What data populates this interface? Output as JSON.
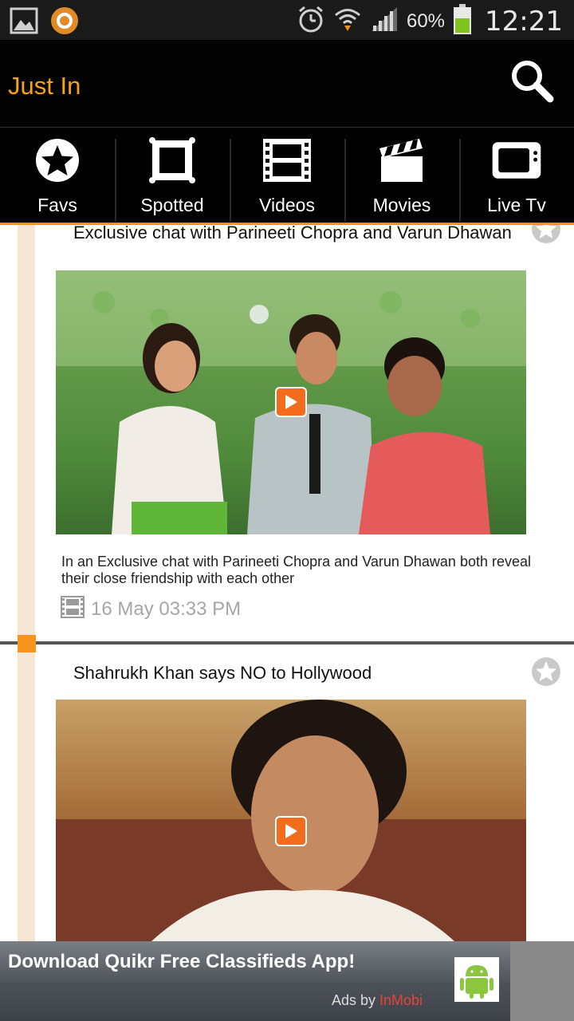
{
  "status_bar": {
    "battery_percent": "60%",
    "time": "12:21",
    "icons": [
      "gallery-icon",
      "app-notification-icon",
      "alarm-icon",
      "wifi-icon",
      "signal-icon",
      "battery-icon"
    ]
  },
  "action_bar": {
    "title": "Just In",
    "title_color": "#f6a21b",
    "search_icon": "search-icon"
  },
  "tabs": [
    {
      "label": "Favs",
      "icon": "star-icon"
    },
    {
      "label": "Spotted",
      "icon": "frame-icon"
    },
    {
      "label": "Videos",
      "icon": "film-icon"
    },
    {
      "label": "Movies",
      "icon": "clapper-icon"
    },
    {
      "label": "Live Tv",
      "icon": "tv-icon"
    }
  ],
  "feed": {
    "items": [
      {
        "title": "Exclusive chat with Parineeti Chopra and Varun Dhawan",
        "description": "In an Exclusive chat with Parineeti Chopra and Varun Dhawan both reveal their close friendship with each other",
        "timestamp": "16 May 03:33 PM",
        "type_icon": "film-icon"
      },
      {
        "title": "Shahrukh Khan says NO to Hollywood"
      }
    ]
  },
  "ad": {
    "title": "Download Quikr Free Classifieds App!",
    "by_prefix": "Ads by ",
    "by_brand": "InMobi",
    "brand_color": "#e8403a"
  },
  "accent_color": "#f39217"
}
